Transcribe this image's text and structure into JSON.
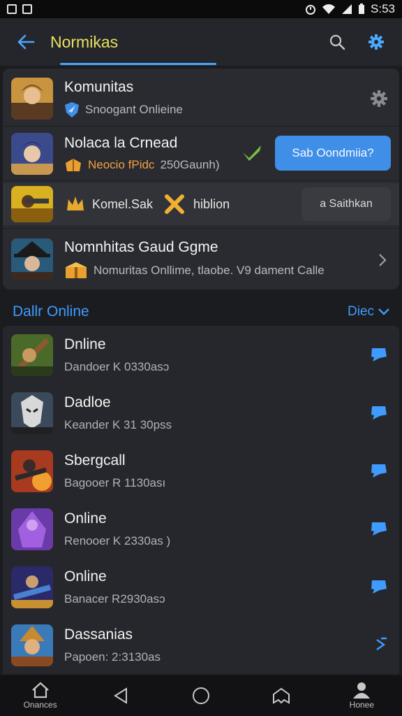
{
  "status_bar": {
    "time": "S:53",
    "left_icons": [
      "gallery-icon",
      "notification-icon"
    ],
    "right_icons": [
      "alarm-icon",
      "wifi-icon",
      "signal-icon",
      "battery-icon"
    ]
  },
  "app_bar": {
    "title": "Normikas",
    "back_icon": "arrow-left-icon",
    "search_icon": "search-icon",
    "settings_icon": "gear-icon"
  },
  "top_card": {
    "items": [
      {
        "title": "Komunitas",
        "subtitle": "Snoogant Onlieine",
        "sub_icon": "shield-icon",
        "trailing_icon": "gear-icon"
      },
      {
        "title": "Nolaca la Crnead",
        "subtitle_accent": "Neocio fPidc",
        "subtitle": "250Gaunh)",
        "sub_icon": "chest-icon",
        "check_icon": "check-icon",
        "button_label": "Sab Oondmiia?"
      },
      {
        "label_a": "Komel.Sak",
        "label_b": "hiblion",
        "icon_a": "crown-icon",
        "icon_b": "crossed-swords-icon",
        "button_label": "a Saithkan"
      },
      {
        "title": "Nomnhitas Gaud Ggme",
        "subtitle": "Nomuritas Onllime, tlaobe. V9 dament Calle",
        "sub_icon": "chest-icon",
        "trailing_icon": "chevron-right-icon"
      }
    ]
  },
  "section": {
    "title": "Dallr Online",
    "action_label": "Diec",
    "action_icon": "chevron-down-icon"
  },
  "list": [
    {
      "title": "Dnline",
      "subtitle": "Dandoer K 0330asɔ",
      "trailing_icon": "chat-bubble-icon"
    },
    {
      "title": "Dadloe",
      "subtitle": "Keander K 31 30pss",
      "trailing_icon": "chat-bubble-icon"
    },
    {
      "title": "Sbergcall",
      "subtitle": "Bagooer R 1130ası",
      "trailing_icon": "chat-bubble-icon"
    },
    {
      "title": "Online",
      "subtitle": "Renooer K 2330as )",
      "trailing_icon": "chat-bubble-icon"
    },
    {
      "title": "Online",
      "subtitle": "Banacer R2930asɔ",
      "trailing_icon": "chat-bubble-icon"
    },
    {
      "title": "Dassanias",
      "subtitle": "Papoen: 2:3130as",
      "trailing_icon": "send-arrow-icon"
    }
  ],
  "nav_bar": [
    {
      "icon": "home-icon",
      "label": "Onances"
    },
    {
      "icon": "back-triangle-icon",
      "label": ""
    },
    {
      "icon": "home-circle-icon",
      "label": ""
    },
    {
      "icon": "house-outline-icon",
      "label": ""
    },
    {
      "icon": "profile-icon",
      "label": "Honee"
    }
  ],
  "colors": {
    "accent": "#3f9bff",
    "button": "#3f8ee8",
    "title_yellow": "#e8e060",
    "background": "#1b1c20",
    "card": "#2a2b30"
  }
}
